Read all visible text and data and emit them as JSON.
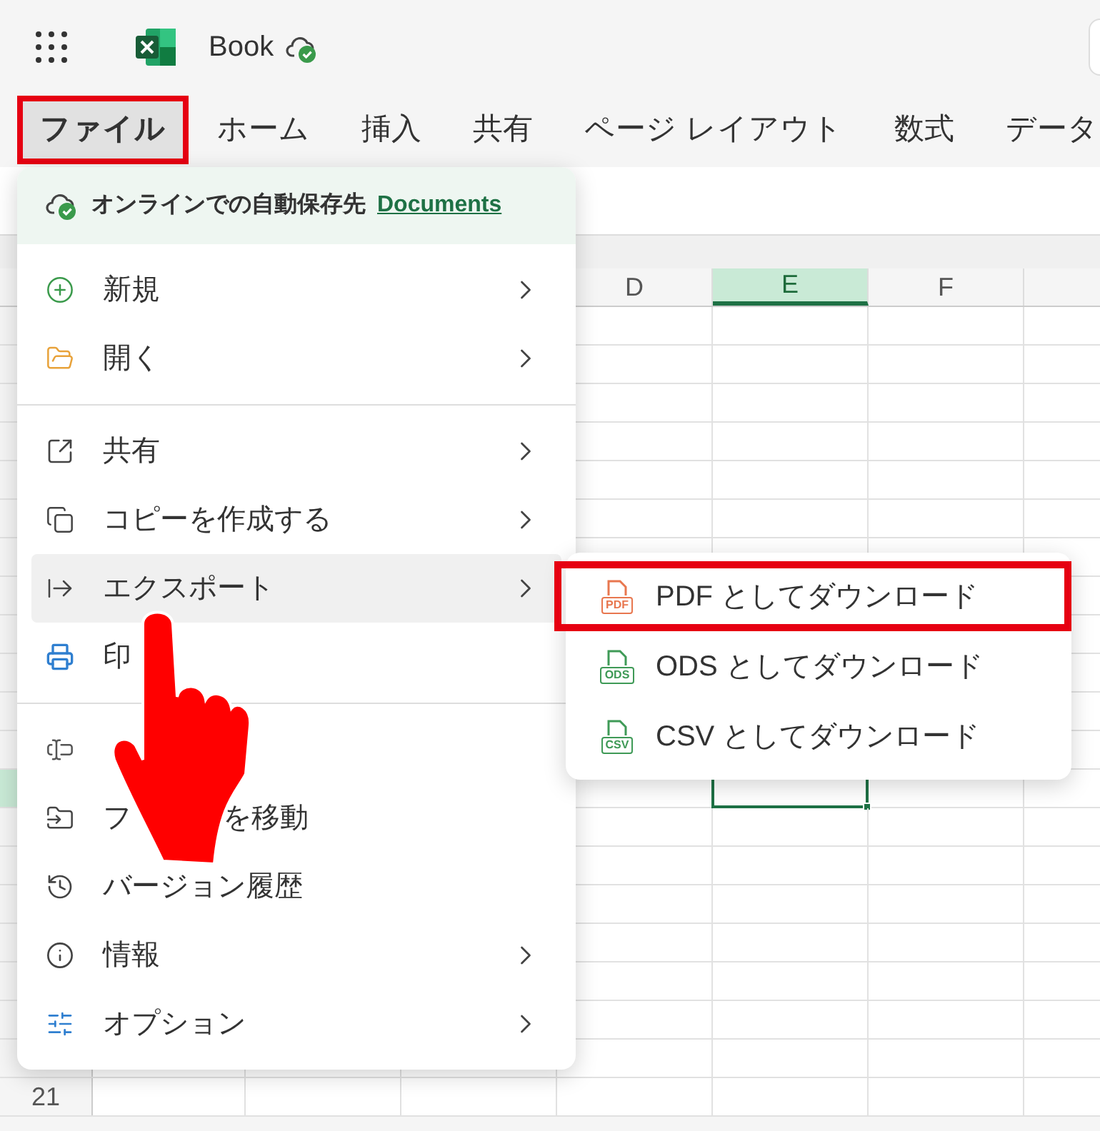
{
  "app_bar": {
    "title": "Book"
  },
  "tabs": [
    {
      "label": "ファイル",
      "selected": true,
      "highlighted": true
    },
    {
      "label": "ホーム",
      "selected": false,
      "highlighted": false
    },
    {
      "label": "挿入",
      "selected": false,
      "highlighted": false
    },
    {
      "label": "共有",
      "selected": false,
      "highlighted": false
    },
    {
      "label": "ページ レイアウト",
      "selected": false,
      "highlighted": false
    },
    {
      "label": "数式",
      "selected": false,
      "highlighted": false
    },
    {
      "label": "データ",
      "selected": false,
      "highlighted": false
    }
  ],
  "sheet": {
    "columns": [
      {
        "label": "D",
        "selected": false
      },
      {
        "label": "E",
        "selected": true
      },
      {
        "label": "F",
        "selected": false
      }
    ],
    "rows": [
      {
        "selected": false
      },
      {
        "selected": false
      },
      {
        "selected": false
      },
      {
        "selected": false
      },
      {
        "selected": false
      },
      {
        "selected": false
      },
      {
        "selected": false
      },
      {
        "selected": false
      },
      {
        "selected": false
      },
      {
        "selected": false
      },
      {
        "selected": false
      },
      {
        "selected": false
      },
      {
        "selected": true
      },
      {
        "selected": false
      },
      {
        "selected": false
      },
      {
        "selected": false
      },
      {
        "selected": false
      },
      {
        "selected": false
      },
      {
        "selected": false
      },
      {
        "selected": false
      },
      {
        "label": "21",
        "selected": false
      }
    ]
  },
  "file_menu": {
    "autosave": {
      "text": "オンラインでの自動保存先",
      "link": "Documents"
    },
    "items": [
      {
        "kind": "item",
        "label": "新規",
        "submenu": true,
        "selected": false
      },
      {
        "kind": "item",
        "label": "開く",
        "submenu": true,
        "selected": false
      },
      {
        "kind": "divider"
      },
      {
        "kind": "item",
        "label": "共有",
        "submenu": true,
        "selected": false
      },
      {
        "kind": "item",
        "label": "コピーを作成する",
        "submenu": true,
        "selected": false
      },
      {
        "kind": "item",
        "label": "エクスポート",
        "submenu": true,
        "selected": true
      },
      {
        "kind": "item",
        "label": "印",
        "submenu": false,
        "selected": false
      },
      {
        "kind": "divider"
      },
      {
        "kind": "item",
        "submenu": false,
        "selected": false
      },
      {
        "kind": "item",
        "label": "フ",
        "label_tail": "を移動",
        "submenu": false,
        "selected": false
      },
      {
        "kind": "item",
        "label": "バージョン履歴",
        "submenu": false,
        "selected": false
      },
      {
        "kind": "item",
        "label": "情報",
        "submenu": true,
        "selected": false
      },
      {
        "kind": "item",
        "label": "オプション",
        "submenu": true,
        "selected": false
      }
    ]
  },
  "export_menu": [
    {
      "badge": "PDF",
      "color": "#e8774f",
      "label": "PDF としてダウンロード",
      "highlighted": true
    },
    {
      "badge": "ODS",
      "color": "#3f9a57",
      "label": "ODS としてダウンロード",
      "highlighted": false
    },
    {
      "badge": "CSV",
      "color": "#3f9a57",
      "label": "CSV としてダウンロード",
      "highlighted": false
    }
  ]
}
